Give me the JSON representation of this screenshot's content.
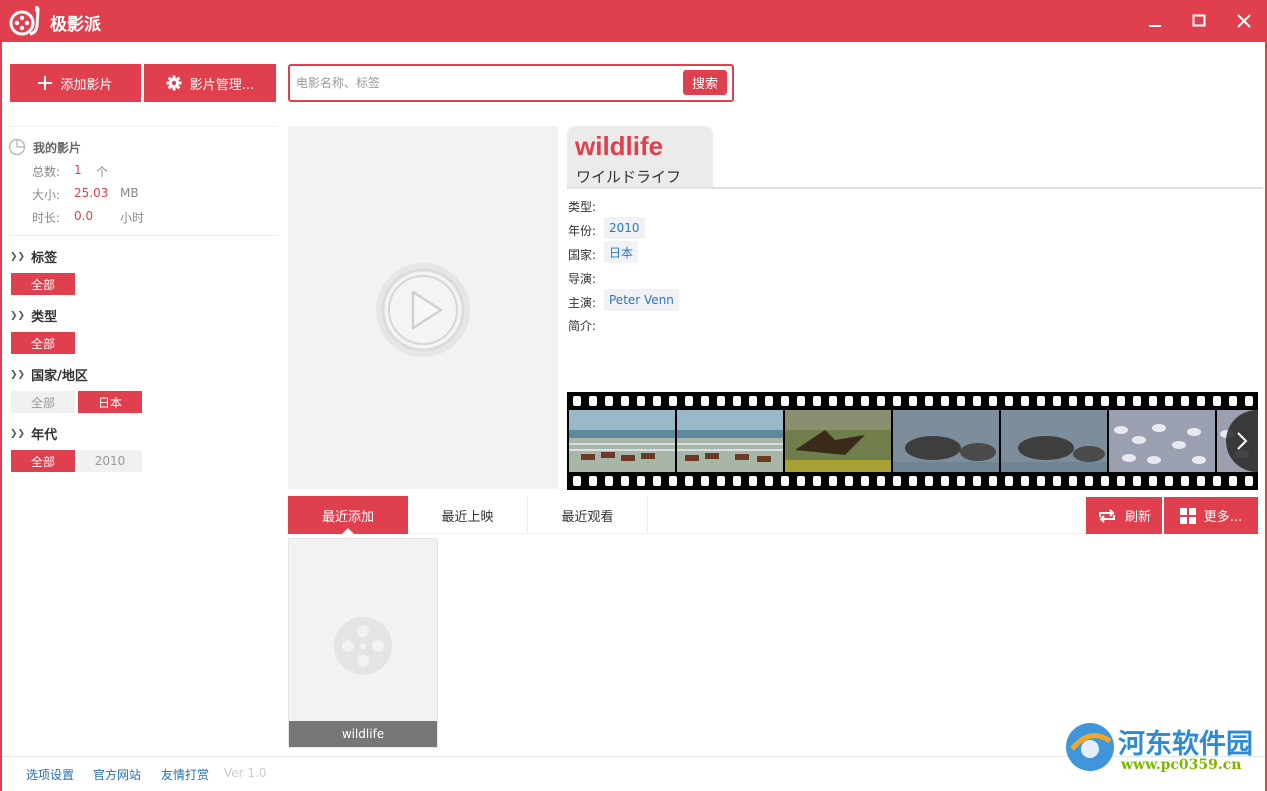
{
  "app": {
    "title": "极影派"
  },
  "toolbar": {
    "add_label": "添加影片",
    "manage_label": "影片管理..."
  },
  "search": {
    "placeholder": "电影名称、标签",
    "button_label": "搜索"
  },
  "library": {
    "title": "我的影片",
    "total_label": "总数:",
    "total_value": "1",
    "total_unit": "个",
    "size_label": "大小:",
    "size_value": "25.03",
    "size_unit": "MB",
    "duration_label": "时长:",
    "duration_value": "0.0",
    "duration_unit": "小时"
  },
  "filters": {
    "tags": {
      "title": "标签",
      "options": [
        "全部"
      ]
    },
    "type": {
      "title": "类型",
      "options": [
        "全部"
      ]
    },
    "country": {
      "title": "国家/地区",
      "options": [
        "全部",
        "日本"
      ],
      "selected": "日本"
    },
    "year": {
      "title": "年代",
      "options": [
        "全部",
        "2010"
      ],
      "selected": "全部"
    }
  },
  "movie": {
    "title_en": "wildlife",
    "title_jp": "ワイルドライフ",
    "labels": {
      "type": "类型:",
      "year": "年份:",
      "country": "国家:",
      "director": "导演:",
      "cast": "主演:",
      "intro": "简介:"
    },
    "year": "2010",
    "country": "日本",
    "cast": "Peter Venn"
  },
  "tabs": [
    "最近添加",
    "最近上映",
    "最近观看"
  ],
  "actions": {
    "refresh_label": "刷新",
    "more_label": "更多..."
  },
  "cards": [
    {
      "name": "wildlife"
    }
  ],
  "footer": {
    "settings": "选项设置",
    "website": "官方网站",
    "donate": "友情打赏",
    "version": "Ver 1.0"
  },
  "watermark": {
    "name": "河东软件园",
    "url": "www.pc0359.cn"
  },
  "colors": {
    "accent": "#e0404e",
    "link": "#2a6fb0"
  }
}
